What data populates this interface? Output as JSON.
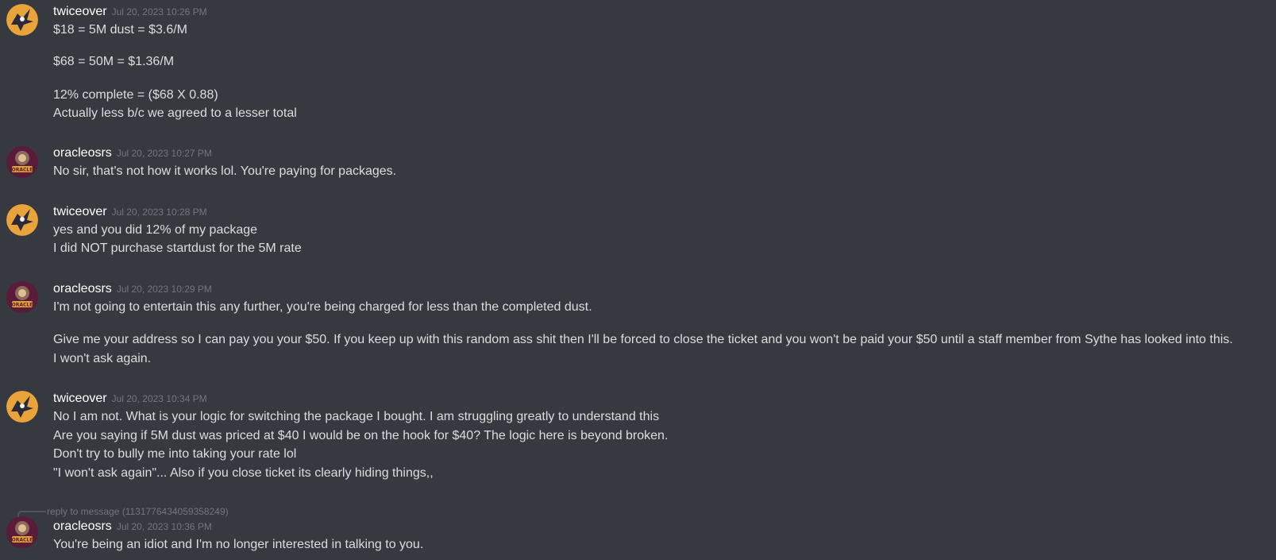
{
  "users": {
    "twiceover": "twiceover",
    "oracleosrs": "oracleosrs"
  },
  "avatars": {
    "twiceover": {
      "icon": "hawk-avatar-icon",
      "bg": "#e8a43a",
      "fg": "#2a2a3a"
    },
    "oracleosrs": {
      "icon": "oracle-avatar-icon",
      "bg": "#5a1a3a",
      "fg": "#e0a030",
      "caption": "ORACLE"
    }
  },
  "messages": [
    {
      "user": "twiceover",
      "timestamp": "Jul 20, 2023 10:26 PM",
      "lines": [
        "$18 = 5M dust = $3.6/M",
        "$68 = 50M = $1.36/M",
        "12% complete = ($68 X 0.88)",
        "Actually less b/c we agreed to a lesser total"
      ]
    },
    {
      "user": "oracleosrs",
      "timestamp": "Jul 20, 2023 10:27 PM",
      "lines": [
        "No sir, that's not how it works lol. You're paying for packages."
      ]
    },
    {
      "user": "twiceover",
      "timestamp": "Jul 20, 2023 10:28 PM",
      "lines": [
        "yes and you did 12% of my package",
        "I did NOT purchase startdust for the 5M rate"
      ]
    },
    {
      "user": "oracleosrs",
      "timestamp": "Jul 20, 2023 10:29 PM",
      "lines": [
        "I'm not going to entertain this any further, you're being charged for less than the completed dust.",
        "Give me your address so I can pay you your $50. If you keep up with this random ass shit then I'll be forced to close the ticket and you won't be paid your $50 until a staff member from Sythe has looked into this.",
        "I won't ask again."
      ]
    },
    {
      "user": "twiceover",
      "timestamp": "Jul 20, 2023 10:34 PM",
      "lines": [
        "No I am not. What is your logic for switching the package I bought. I am struggling greatly to understand this",
        "Are you saying if 5M dust was priced at $40 I would be on the hook for $40? The logic here is beyond broken.",
        "Don't try to bully me into taking your rate lol",
        "\"I won't ask again\"... Also if you close ticket its clearly hiding things,,"
      ]
    },
    {
      "user": "oracleosrs",
      "timestamp": "Jul 20, 2023 10:36 PM",
      "reply": "reply to message (1131776434059358249)",
      "lines": [
        "You're being an idiot and I'm no longer interested in talking to you."
      ]
    }
  ]
}
